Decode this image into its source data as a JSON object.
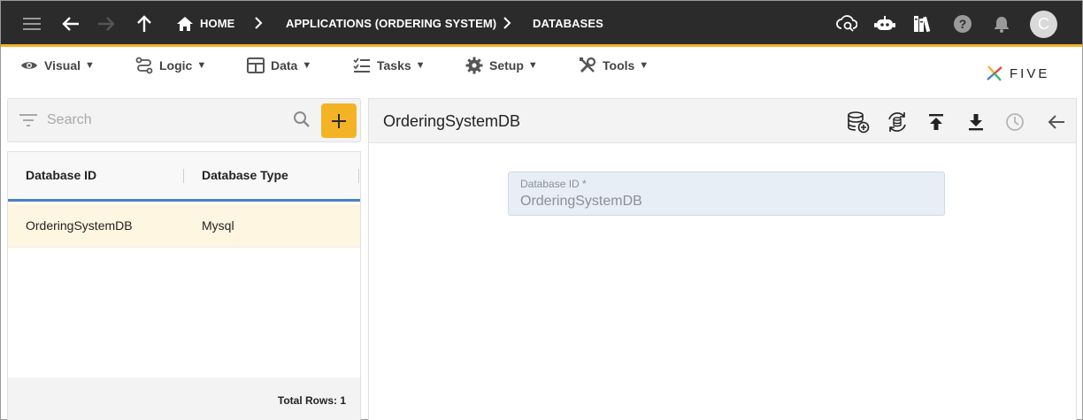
{
  "topbar": {
    "breadcrumbs": [
      "HOME",
      "APPLICATIONS (ORDERING SYSTEM)",
      "DATABASES"
    ],
    "avatar_initial": "C",
    "accent_color": "#f4b324",
    "icons": [
      "menu-icon",
      "back-icon",
      "forward-icon",
      "up-icon",
      "home-icon",
      "chevron-right-icon",
      "cloud-search-icon",
      "chatbot-icon",
      "library-icon",
      "help-icon",
      "bell-icon"
    ]
  },
  "menu": {
    "items": [
      {
        "label": "Visual",
        "icon": "eye-icon"
      },
      {
        "label": "Logic",
        "icon": "logic-icon"
      },
      {
        "label": "Data",
        "icon": "table-icon"
      },
      {
        "label": "Tasks",
        "icon": "tasks-icon"
      },
      {
        "label": "Setup",
        "icon": "gear-icon"
      },
      {
        "label": "Tools",
        "icon": "tools-icon"
      }
    ],
    "caret": "▼",
    "logo_text": "FIVE"
  },
  "search": {
    "placeholder": "Search"
  },
  "list": {
    "columns": [
      "Database ID",
      "Database Type"
    ],
    "rows": [
      {
        "database_id": "OrderingSystemDB",
        "database_type": "Mysql"
      }
    ],
    "total_rows": "Total Rows: 1"
  },
  "detail": {
    "title": "OrderingSystemDB",
    "field_label": "Database ID *",
    "field_value": "OrderingSystemDB"
  }
}
